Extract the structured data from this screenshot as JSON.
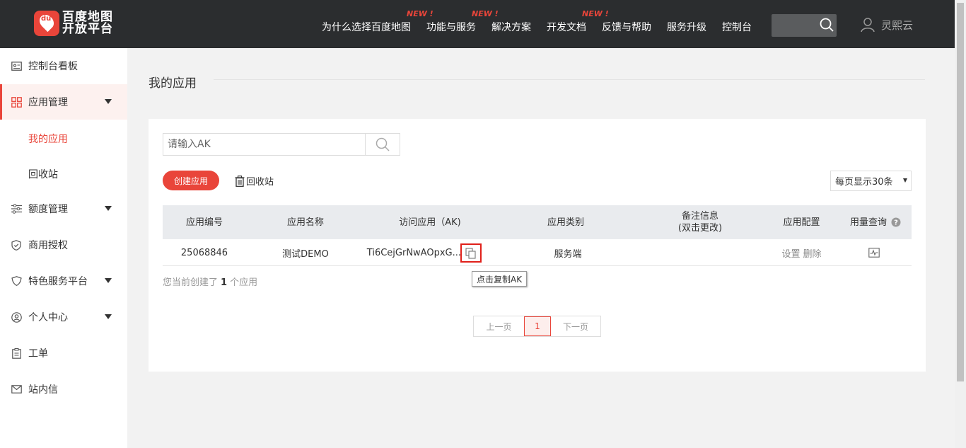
{
  "header": {
    "logo_line1": "百度地图",
    "logo_line2": "开放平台",
    "logo_badge": "du",
    "nav": [
      {
        "label": "为什么选择百度地图",
        "new": ""
      },
      {
        "label": "功能与服务",
        "new": "NEW !"
      },
      {
        "label": "解决方案",
        "new": "NEW !"
      },
      {
        "label": "开发文档",
        "new": "NEW !"
      },
      {
        "label": "反馈与帮助",
        "new": ""
      },
      {
        "label": "服务升级",
        "new": ""
      },
      {
        "label": "控制台",
        "new": ""
      }
    ],
    "username": "灵熙云"
  },
  "sidebar": {
    "items": [
      {
        "label": "控制台看板",
        "icon": "dashboard-icon"
      },
      {
        "label": "应用管理",
        "icon": "grid-icon",
        "expanded": true
      },
      {
        "label": "我的应用",
        "sub": true,
        "active": true
      },
      {
        "label": "回收站",
        "sub": true
      },
      {
        "label": "额度管理",
        "icon": "sliders-icon"
      },
      {
        "label": "商用授权",
        "icon": "shield-icon"
      },
      {
        "label": "特色服务平台",
        "icon": "heart-shield-icon"
      },
      {
        "label": "个人中心",
        "icon": "user-circle-icon"
      },
      {
        "label": "工单",
        "icon": "clipboard-icon"
      },
      {
        "label": "站内信",
        "icon": "mail-icon"
      }
    ]
  },
  "main": {
    "title": "我的应用",
    "search_placeholder": "请输入AK",
    "create_button": "创建应用",
    "recycle_label": "回收站",
    "per_page": "每页显示30条",
    "table": {
      "headers": [
        "应用编号",
        "应用名称",
        "访问应用（AK)",
        "应用类别",
        "备注信息",
        "(双击更改)",
        "应用配置",
        "用量查询"
      ],
      "row": {
        "id": "25068846",
        "name": "测试DEMO",
        "ak": "Ti6CejGrNwAOpxG...",
        "category": "服务端",
        "note": "",
        "settings": "设置",
        "delete": "删除"
      }
    },
    "tooltip": "点击复制AK",
    "count_prefix": "您当前创建了",
    "count_value": "1",
    "count_suffix": "个应用",
    "pager": {
      "prev": "上一页",
      "current": "1",
      "next": "下一页"
    }
  },
  "colors": {
    "accent": "#e9453a",
    "header_bg": "#2b2d2f",
    "table_header_bg": "#e9ebee"
  }
}
